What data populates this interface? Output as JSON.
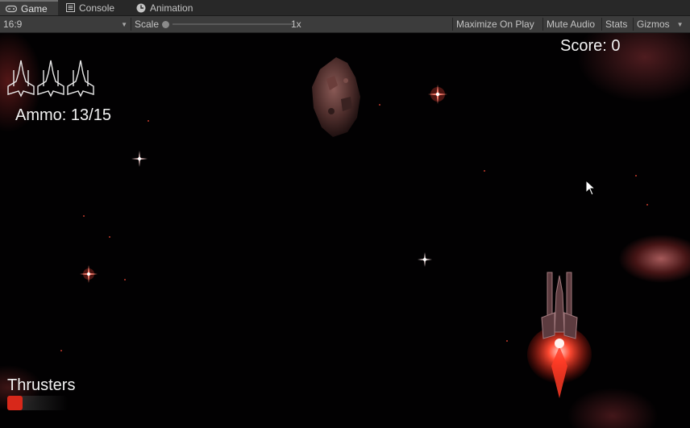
{
  "tabs": [
    {
      "label": "Game",
      "icon": "gamepad-icon"
    },
    {
      "label": "Console",
      "icon": "console-icon"
    },
    {
      "label": "Animation",
      "icon": "clock-icon"
    }
  ],
  "toolbar": {
    "aspect": "16:9",
    "scale_label": "Scale",
    "scale_value": "1x",
    "maximize_label": "Maximize On Play",
    "mute_label": "Mute Audio",
    "stats_label": "Stats",
    "gizmos_label": "Gizmos"
  },
  "hud": {
    "score": "Score: 0",
    "ammo": "Ammo: 13/15",
    "thrusters_label": "Thrusters",
    "thrusters_level": 0.08,
    "lives": 3
  },
  "colors": {
    "editor_bg": "#3c3c3c",
    "thruster_fill": "#d8281a",
    "ship_glow": "#ff3322"
  }
}
